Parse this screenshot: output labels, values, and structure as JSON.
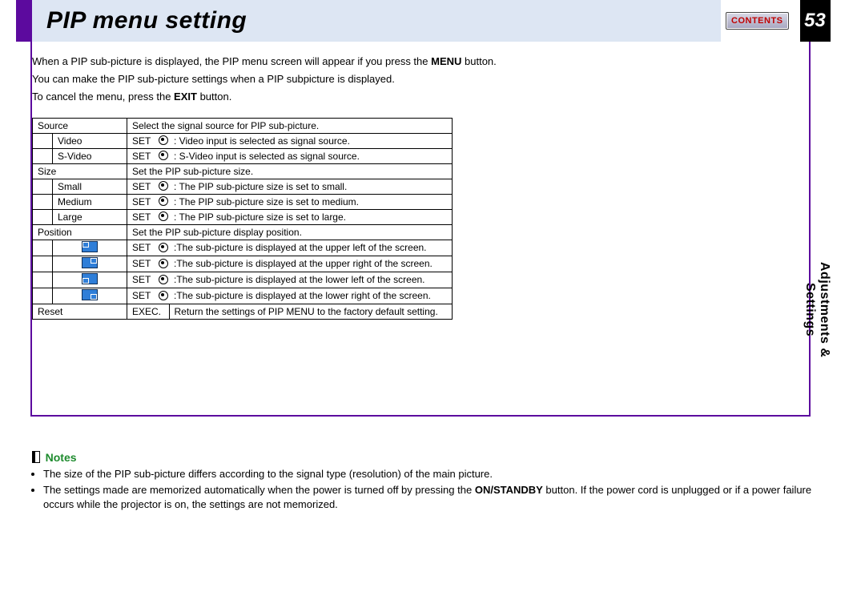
{
  "title": "PIP menu setting",
  "contents_label": "CONTENTS",
  "page_number": "53",
  "side_tab_line1": "Adjustments &",
  "side_tab_line2": "Settings",
  "intro": {
    "p1a": "When a PIP sub-picture is displayed, the PIP menu screen will appear if you press the ",
    "p1b": "MENU",
    "p1c": " button.",
    "p2": "You can make the PIP sub-picture settings when a PIP subpicture is displayed.",
    "p3a": "To cancel the menu, press the ",
    "p3b": "EXIT",
    "p3c": " button."
  },
  "table": {
    "source": {
      "label": "Source",
      "desc": "Select the signal source for PIP sub-picture."
    },
    "video": {
      "label": "Video",
      "set": "SET",
      "desc": ": Video input is selected as signal source."
    },
    "svideo": {
      "label": "S-Video",
      "set": "SET",
      "desc": ": S-Video input is selected as signal source."
    },
    "size": {
      "label": "Size",
      "desc": "Set the PIP sub-picture size."
    },
    "small": {
      "label": "Small",
      "set": "SET",
      "desc": ": The PIP sub-picture size is set to small."
    },
    "medium": {
      "label": "Medium",
      "set": "SET",
      "desc": ": The PIP sub-picture size is set to medium."
    },
    "large": {
      "label": "Large",
      "set": "SET",
      "desc": ": The PIP sub-picture size is set to large."
    },
    "position": {
      "label": "Position",
      "desc": "Set the PIP sub-picture display position."
    },
    "pos_ul": {
      "set": "SET",
      "desc": ":The sub-picture is displayed at the upper left of the screen."
    },
    "pos_ur": {
      "set": "SET",
      "desc": ":The sub-picture is displayed at the upper right of the screen."
    },
    "pos_ll": {
      "set": "SET",
      "desc": ":The sub-picture is displayed at the lower left of the screen."
    },
    "pos_lr": {
      "set": "SET",
      "desc": ":The sub-picture is displayed at the lower right of the screen."
    },
    "reset": {
      "label": "Reset",
      "set": "EXEC.",
      "desc": "Return the settings of PIP MENU to the factory default setting."
    }
  },
  "notes": {
    "heading": "Notes",
    "n1": "The size of the PIP sub-picture differs according to the signal type (resolution) of the main picture.",
    "n2a": "The settings made are memorized automatically when the power is turned off by pressing the ",
    "n2b": "ON/STANDBY",
    "n2c": " button. If the power cord is unplugged or if a power failure occurs while the projector is on, the settings are not memorized."
  }
}
